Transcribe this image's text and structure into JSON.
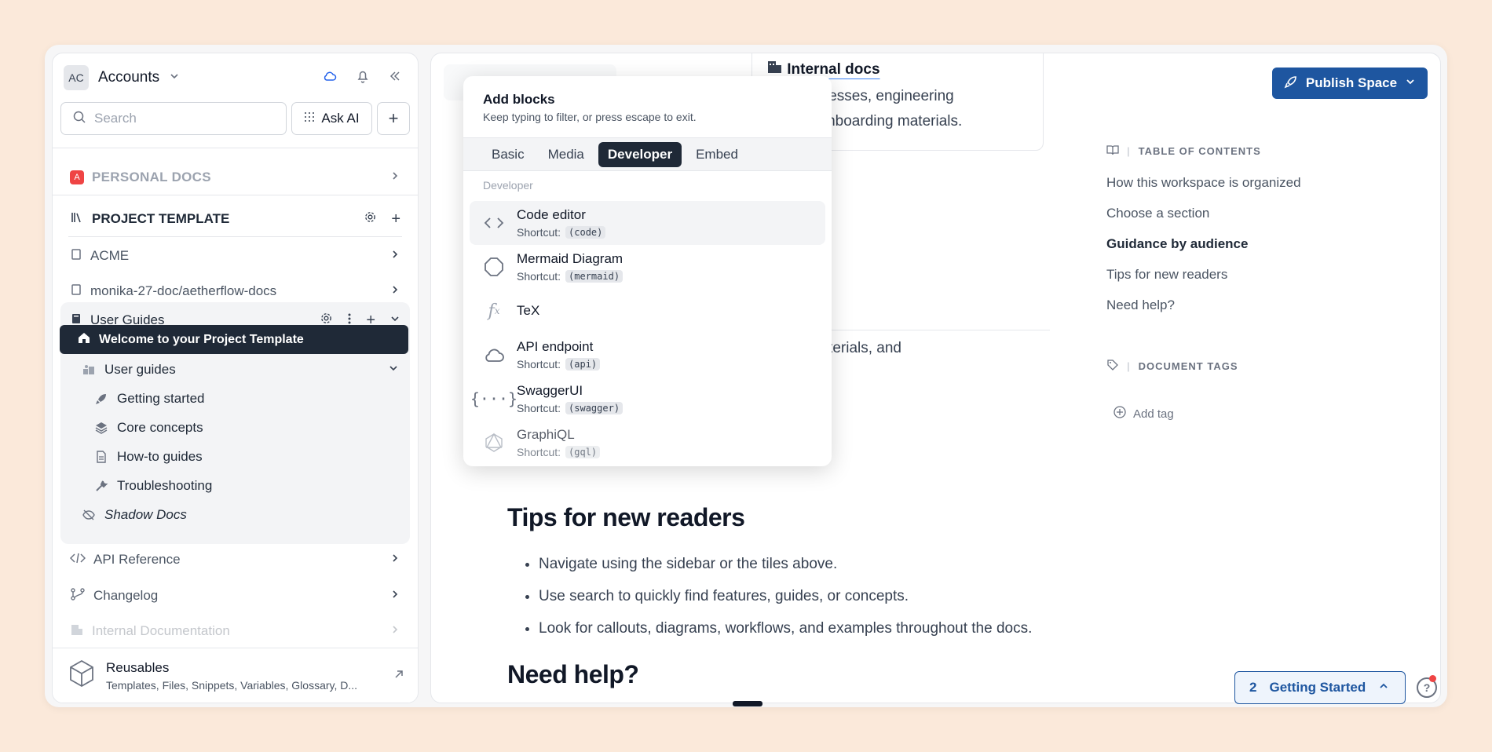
{
  "sidebar": {
    "account_initials": "AC",
    "account_name": "Accounts",
    "search_placeholder": "Search",
    "ask_ai_label": "Ask AI",
    "sections": {
      "personal_docs": "PERSONAL DOCS",
      "personal_badge": "A",
      "project_template": "PROJECT TEMPLATE",
      "acme": "ACME",
      "monika": "monika-27-doc/aetherflow-docs",
      "user_guides": "User Guides",
      "api_reference": "API Reference",
      "changelog": "Changelog",
      "internal_documentation": "Internal Documentation"
    },
    "active_page": "Welcome to your Project Template",
    "user_guides_folder": "User guides",
    "sub_items": [
      "Getting started",
      "Core concepts",
      "How-to guides",
      "Troubleshooting"
    ],
    "shadow_docs": "Shadow Docs",
    "reusables_title": "Reusables",
    "reusables_sub": "Templates, Files, Snippets, Variables, Glossary, D..."
  },
  "main": {
    "internal_docs_link": "Internal docs",
    "card_line1": "eam processes, engineering",
    "card_line2": "ys, and onboarding materials.",
    "partial_line": "oarding materials, and",
    "tips_heading": "Tips for new readers",
    "bullets": [
      "Navigate using the sidebar or the tiles above.",
      "Use search to quickly find features, guides, or concepts.",
      "Look for callouts, diagrams, workflows, and examples throughout the docs."
    ],
    "help_heading": "Need help?",
    "publish_label": "Publish Space",
    "toc_title": "TABLE OF CONTENTS",
    "toc_items": [
      "How this workspace is organized",
      "Choose a section",
      "Guidance by audience",
      "Tips for new readers",
      "Need help?"
    ],
    "tags_title": "DOCUMENT TAGS",
    "add_tag_label": "Add tag",
    "getting_started_count": "2",
    "getting_started_label": "Getting Started"
  },
  "popup": {
    "title": "Add blocks",
    "subtitle": "Keep typing to filter, or press escape to exit.",
    "tabs": [
      "Basic",
      "Media",
      "Developer",
      "Embed"
    ],
    "group_label": "Developer",
    "shortcut_prefix": "Shortcut:",
    "items": [
      {
        "name": "Code editor",
        "shortcut": "(code)"
      },
      {
        "name": "Mermaid Diagram",
        "shortcut": "(mermaid)"
      },
      {
        "name": "TeX",
        "shortcut": ""
      },
      {
        "name": "API endpoint",
        "shortcut": "(api)"
      },
      {
        "name": "SwaggerUI",
        "shortcut": "(swagger)"
      },
      {
        "name": "GraphiQL",
        "shortcut": "(gql)"
      }
    ]
  },
  "colors": {
    "background": "#fbe9da",
    "accent": "#1e56a0",
    "active_item": "#1f2937",
    "notification_dot": "#ef4444"
  }
}
